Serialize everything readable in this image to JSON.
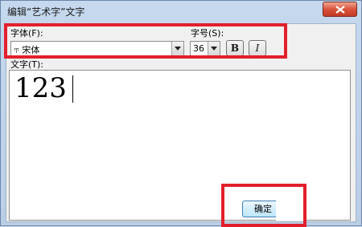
{
  "window": {
    "title": "编辑“艺术字”文字"
  },
  "font": {
    "label": "字体(F):",
    "value": "宋体"
  },
  "size": {
    "label": "字号(S):",
    "value": "36"
  },
  "format": {
    "bold_label": "B",
    "italic_label": "I"
  },
  "text_field": {
    "label": "文字(T):",
    "value": "123"
  },
  "buttons": {
    "ok_label": "确定"
  },
  "colors": {
    "highlight": "#e2202c",
    "close_button": "#c23a22"
  }
}
